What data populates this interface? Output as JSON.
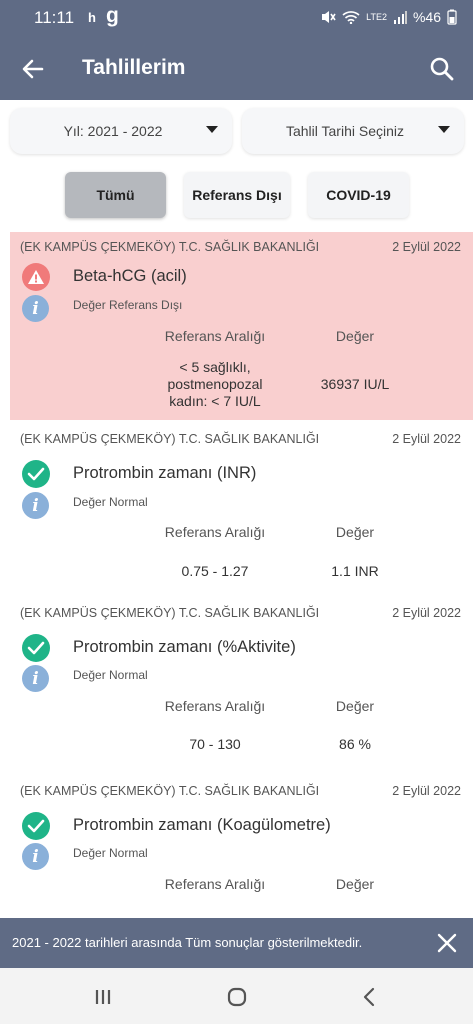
{
  "status_bar": {
    "time": "11:11",
    "notif_h": "h",
    "notif_g": "g",
    "network": "LTE2",
    "battery": "%46"
  },
  "app_bar": {
    "title": "Tahlillerim"
  },
  "filters": {
    "year": "Yıl: 2021 - 2022",
    "date": "Tahlil Tarihi Seçiniz"
  },
  "tabs": [
    {
      "label": "Tümü",
      "active": true
    },
    {
      "label": "Referans Dışı",
      "active": false
    },
    {
      "label": "COVID-19",
      "active": false
    }
  ],
  "table_headers": {
    "reference": "Referans Aralığı",
    "value": "Değer"
  },
  "results": [
    {
      "institution": "(EK KAMPÜS ÇEKMEKÖY) T.C. SAĞLIK BAKANLIĞI",
      "date": "2 Eylül 2022",
      "test": "Beta-hCG (acil)",
      "status": "Değer Referans Dışı",
      "out_of_range": true,
      "reference": "< 5 sağlıklı, postmenopozal kadın: < 7 IU/L",
      "value": "36937 IU/L"
    },
    {
      "institution": "(EK KAMPÜS ÇEKMEKÖY) T.C. SAĞLIK BAKANLIĞI",
      "date": "2 Eylül 2022",
      "test": "Protrombin zamanı (INR)",
      "status": "Değer Normal",
      "out_of_range": false,
      "reference": "0.75 - 1.27",
      "value": "1.1 INR"
    },
    {
      "institution": "(EK KAMPÜS ÇEKMEKÖY) T.C. SAĞLIK BAKANLIĞI",
      "date": "2 Eylül 2022",
      "test": "Protrombin zamanı (%Aktivite)",
      "status": "Değer Normal",
      "out_of_range": false,
      "reference": "70 - 130",
      "value": "86 %"
    },
    {
      "institution": "(EK KAMPÜS ÇEKMEKÖY) T.C. SAĞLIK BAKANLIĞI",
      "date": "2 Eylül 2022",
      "test": "Protrombin zamanı (Koagülometre)",
      "status": "Değer Normal",
      "out_of_range": false,
      "reference": "",
      "value": ""
    }
  ],
  "snackbar": {
    "message": "2021 - 2022 tarihleri arasında Tüm sonuçlar gösterilmektedir."
  },
  "icons": {
    "back": "arrow-left-icon",
    "search": "search-icon",
    "close": "close-icon",
    "ok": "check-circle-icon",
    "warn": "warning-icon",
    "info": "info-icon"
  },
  "colors": {
    "primary": "#5f6b85",
    "out_of_range_bg": "#f9cfcf",
    "ok": "#1fb488",
    "warn": "#f07a7a",
    "info": "#8ab0d9"
  }
}
